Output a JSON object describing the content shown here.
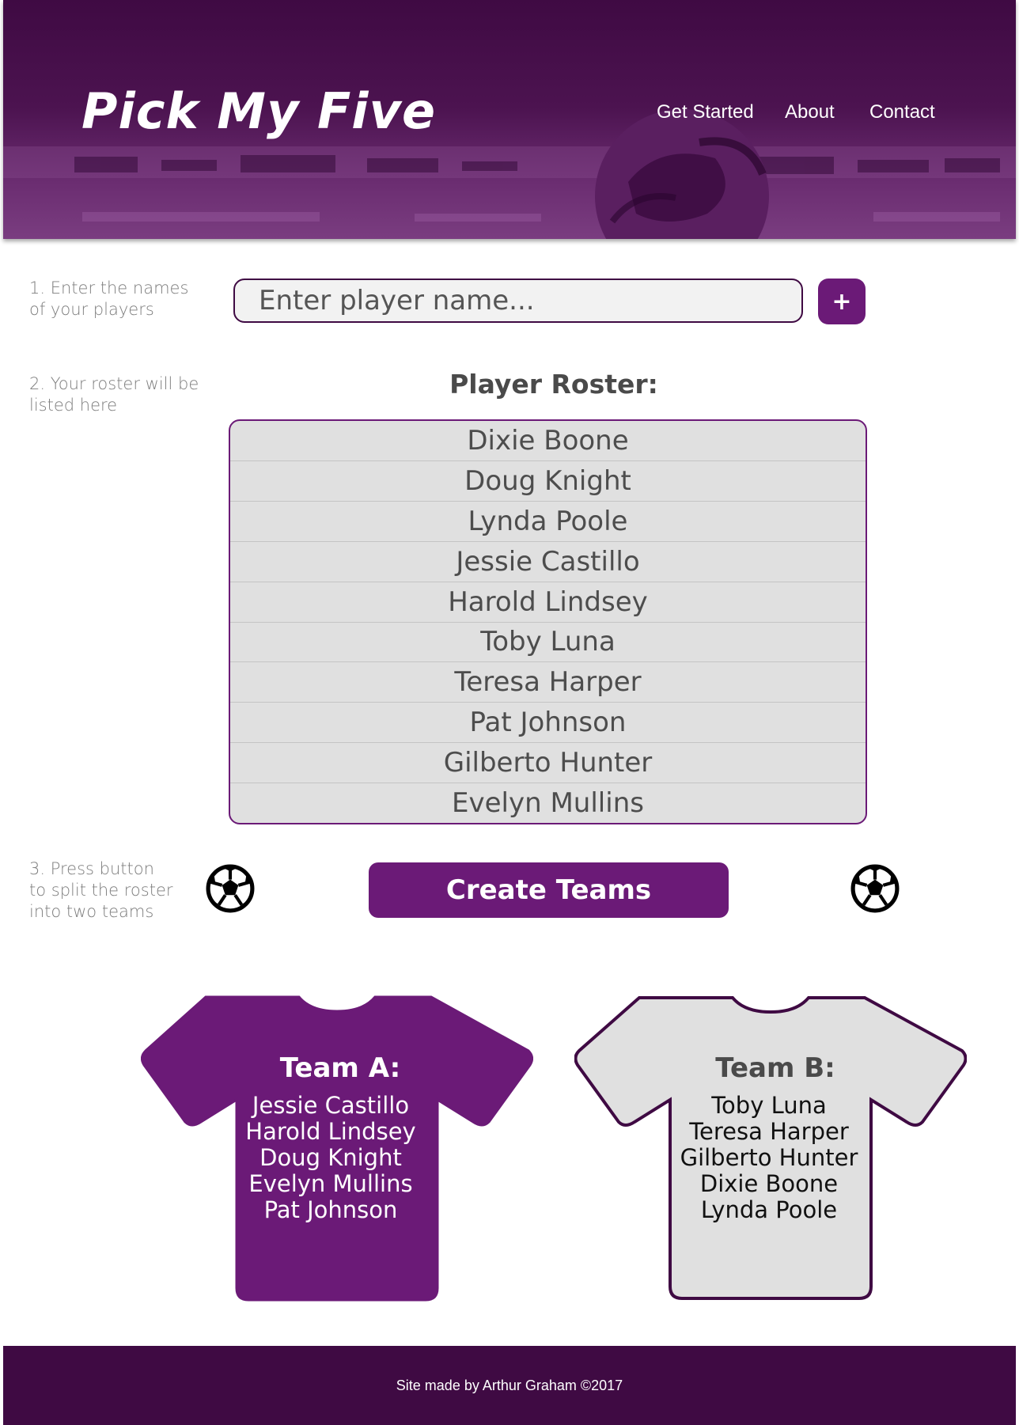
{
  "header": {
    "brand": "Pick My Five",
    "nav": [
      {
        "label": "Get Started"
      },
      {
        "label": "About"
      },
      {
        "label": "Contact"
      }
    ]
  },
  "steps": {
    "step1": "1. Enter the names\nof your players",
    "step2": "2. Your roster will be\n listed here",
    "step3": "3. Press button\nto split the roster\ninto two teams"
  },
  "input": {
    "placeholder": "Enter player name...",
    "add_label": "+"
  },
  "roster": {
    "title": "Player Roster:",
    "players": [
      "Dixie Boone",
      "Doug Knight",
      "Lynda Poole",
      "Jessie Castillo",
      "Harold Lindsey",
      "Toby Luna",
      "Teresa Harper",
      "Pat Johnson",
      "Gilberto Hunter",
      "Evelyn Mullins"
    ]
  },
  "create_button": "Create Teams",
  "icons": {
    "ball": "soccer-ball-icon"
  },
  "teams": {
    "a": {
      "title": "Team A:",
      "color": "#6b1a77",
      "text_color": "#ffffff",
      "players": [
        "Jessie Castillo",
        "Harold Lindsey",
        "Doug Knight",
        "Evelyn Mullins",
        "Pat Johnson"
      ]
    },
    "b": {
      "title": "Team B:",
      "color": "#e0e0e0",
      "text_color": "#111111",
      "players": [
        "Toby Luna",
        "Teresa Harper",
        "Gilberto Hunter",
        "Dixie Boone",
        "Lynda Poole"
      ]
    }
  },
  "footer": "Site made by Arthur Graham ©2017",
  "colors": {
    "primary": "#6b1a77",
    "dark": "#3f0a43",
    "panel": "#e0e0e0"
  }
}
